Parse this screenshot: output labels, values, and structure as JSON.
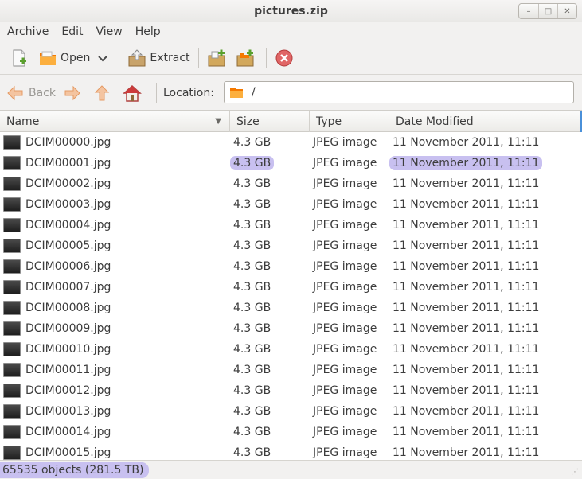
{
  "window": {
    "title": "pictures.zip",
    "controls": [
      "–",
      "□",
      "✕"
    ]
  },
  "menubar": {
    "items": [
      "Archive",
      "Edit",
      "View",
      "Help"
    ]
  },
  "toolbar": {
    "open_label": "Open",
    "extract_label": "Extract"
  },
  "locationbar": {
    "back_label": "Back",
    "location_label": "Location:",
    "location_value": "/"
  },
  "table": {
    "columns": [
      "Name",
      "Size",
      "Type",
      "Date Modified"
    ],
    "highlighted_row_index": 1,
    "rows": [
      {
        "name": "DCIM00000.jpg",
        "size": "4.3 GB",
        "type": "JPEG image",
        "date": "11 November 2011, 11:11"
      },
      {
        "name": "DCIM00001.jpg",
        "size": "4.3 GB",
        "type": "JPEG image",
        "date": "11 November 2011, 11:11"
      },
      {
        "name": "DCIM00002.jpg",
        "size": "4.3 GB",
        "type": "JPEG image",
        "date": "11 November 2011, 11:11"
      },
      {
        "name": "DCIM00003.jpg",
        "size": "4.3 GB",
        "type": "JPEG image",
        "date": "11 November 2011, 11:11"
      },
      {
        "name": "DCIM00004.jpg",
        "size": "4.3 GB",
        "type": "JPEG image",
        "date": "11 November 2011, 11:11"
      },
      {
        "name": "DCIM00005.jpg",
        "size": "4.3 GB",
        "type": "JPEG image",
        "date": "11 November 2011, 11:11"
      },
      {
        "name": "DCIM00006.jpg",
        "size": "4.3 GB",
        "type": "JPEG image",
        "date": "11 November 2011, 11:11"
      },
      {
        "name": "DCIM00007.jpg",
        "size": "4.3 GB",
        "type": "JPEG image",
        "date": "11 November 2011, 11:11"
      },
      {
        "name": "DCIM00008.jpg",
        "size": "4.3 GB",
        "type": "JPEG image",
        "date": "11 November 2011, 11:11"
      },
      {
        "name": "DCIM00009.jpg",
        "size": "4.3 GB",
        "type": "JPEG image",
        "date": "11 November 2011, 11:11"
      },
      {
        "name": "DCIM00010.jpg",
        "size": "4.3 GB",
        "type": "JPEG image",
        "date": "11 November 2011, 11:11"
      },
      {
        "name": "DCIM00011.jpg",
        "size": "4.3 GB",
        "type": "JPEG image",
        "date": "11 November 2011, 11:11"
      },
      {
        "name": "DCIM00012.jpg",
        "size": "4.3 GB",
        "type": "JPEG image",
        "date": "11 November 2011, 11:11"
      },
      {
        "name": "DCIM00013.jpg",
        "size": "4.3 GB",
        "type": "JPEG image",
        "date": "11 November 2011, 11:11"
      },
      {
        "name": "DCIM00014.jpg",
        "size": "4.3 GB",
        "type": "JPEG image",
        "date": "11 November 2011, 11:11"
      },
      {
        "name": "DCIM00015.jpg",
        "size": "4.3 GB",
        "type": "JPEG image",
        "date": "11 November 2011, 11:11"
      }
    ]
  },
  "statusbar": {
    "text": "65535 objects (281.5 TB)"
  },
  "colors": {
    "highlight": "#c8c0f0",
    "column_accent": "#4a90d9",
    "stop_red": "#d9534f",
    "arrow_orange": "#f0a060"
  }
}
